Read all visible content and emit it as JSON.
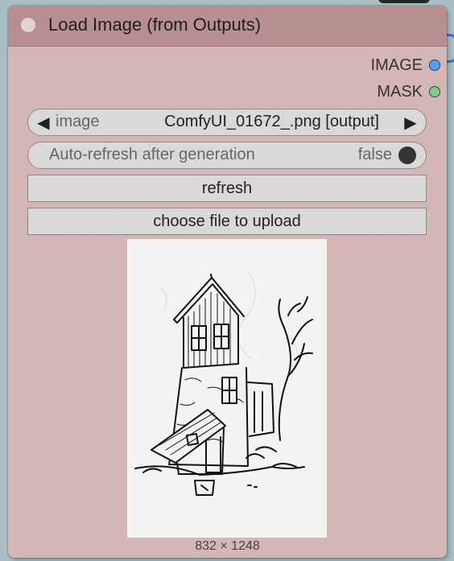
{
  "node": {
    "title": "Load Image (from Outputs)",
    "outputs": [
      {
        "label": "IMAGE",
        "color": "#4da3ff"
      },
      {
        "label": "MASK",
        "color": "#7fd17f"
      }
    ],
    "image_widget": {
      "name": "image",
      "value": "ComfyUI_01672_.png [output]"
    },
    "toggle_widget": {
      "name": "Auto-refresh after generation",
      "value": "false"
    },
    "refresh_label": "refresh",
    "upload_label": "choose file to upload",
    "image_dimensions": "832 × 1248"
  },
  "icons": {
    "prev": "◀",
    "next": "▶"
  },
  "colors": {
    "node_body": "#d5b6b7",
    "node_title": "#b88f90",
    "widget_bg": "#d9d9d9"
  }
}
